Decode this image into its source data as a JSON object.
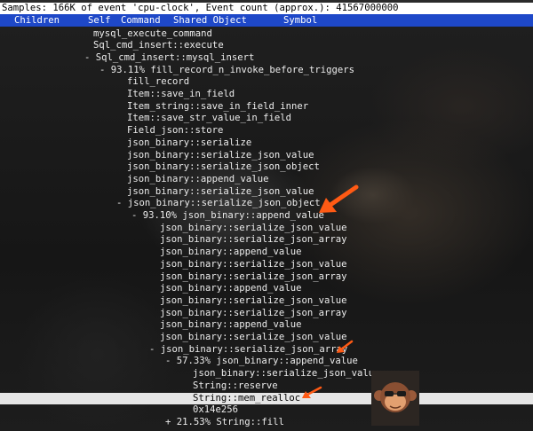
{
  "header": {
    "samples_text": "Samples: 166K of event 'cpu-clock', Event count (approx.): 41567000000"
  },
  "columns": {
    "children": "Children",
    "self": "Self",
    "command": "Command",
    "shared_object": "Shared Object",
    "symbol": "Symbol"
  },
  "call_tree": [
    {
      "text": "mysql_execute_command"
    },
    {
      "text": "Sql_cmd_insert::execute"
    },
    {
      "text": "- Sql_cmd_insert::mysql_insert"
    },
    {
      "text": "- 93.11% fill_record_n_invoke_before_triggers"
    },
    {
      "text": "fill_record"
    },
    {
      "text": "Item::save_in_field"
    },
    {
      "text": "Item_string::save_in_field_inner"
    },
    {
      "text": "Item::save_str_value_in_field"
    },
    {
      "text": "Field_json::store"
    },
    {
      "text": "json_binary::serialize"
    },
    {
      "text": "json_binary::serialize_json_value"
    },
    {
      "text": "json_binary::serialize_json_object"
    },
    {
      "text": "json_binary::append_value"
    },
    {
      "text": "json_binary::serialize_json_value"
    },
    {
      "text": "- json_binary::serialize_json_object"
    },
    {
      "text": "- 93.10% json_binary::append_value"
    },
    {
      "text": "json_binary::serialize_json_value"
    },
    {
      "text": "json_binary::serialize_json_array"
    },
    {
      "text": "json_binary::append_value"
    },
    {
      "text": "json_binary::serialize_json_value"
    },
    {
      "text": "json_binary::serialize_json_array"
    },
    {
      "text": "json_binary::append_value"
    },
    {
      "text": "json_binary::serialize_json_value"
    },
    {
      "text": "json_binary::serialize_json_array"
    },
    {
      "text": "json_binary::append_value"
    },
    {
      "text": "json_binary::serialize_json_value"
    },
    {
      "text": "- json_binary::serialize_json_array"
    },
    {
      "text": "- 57.33% json_binary::append_value"
    },
    {
      "text": "json_binary::serialize_json_value"
    },
    {
      "text": "String::reserve"
    },
    {
      "text": "String::mem_realloc"
    },
    {
      "text": "0x14e256"
    },
    {
      "text": "+ 21.53% String::fill"
    }
  ],
  "selected_index": 30,
  "colors": {
    "header_bg": "#ffffff",
    "column_bar_bg": "#1e48c8",
    "selection_bg": "#e6e6e6",
    "annotation_arrow": "#ff5a14"
  },
  "icons": {
    "annotation": "arrow-icon",
    "avatar": "monkey-avatar-icon"
  }
}
